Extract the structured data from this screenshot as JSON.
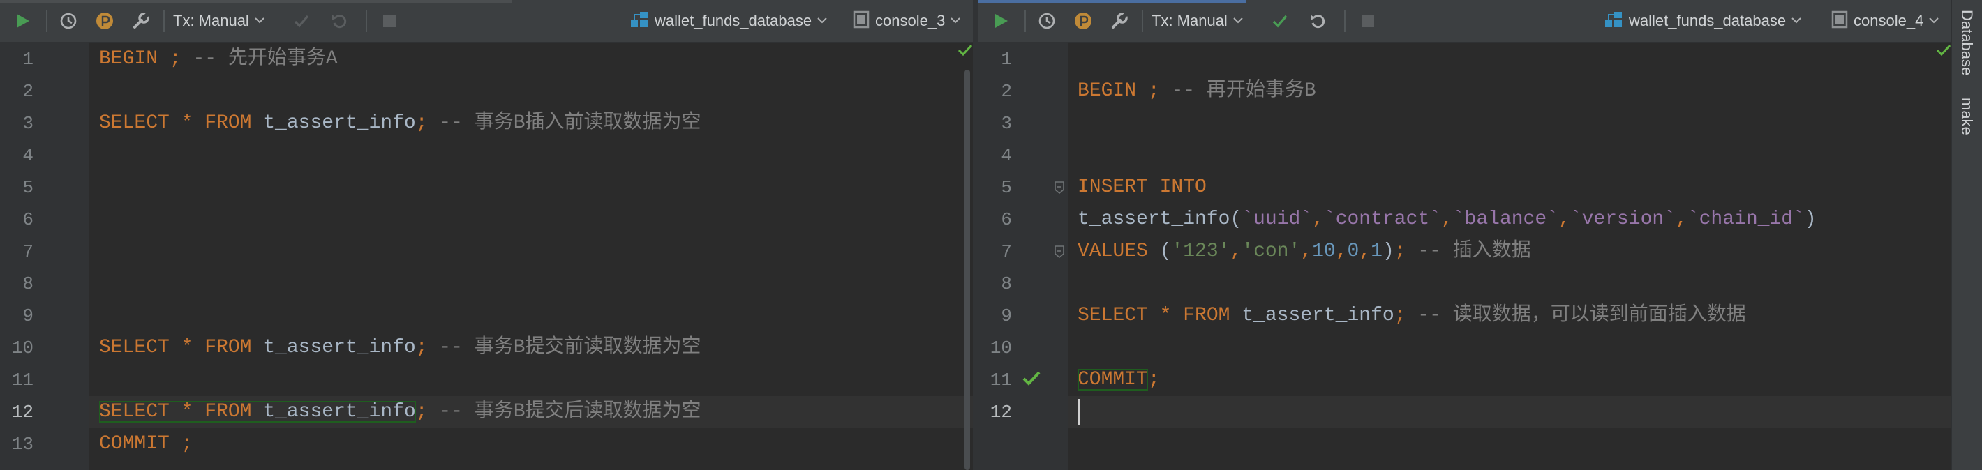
{
  "toolbar_left": {
    "tx_mode": "Tx: Manual",
    "datasource": "wallet_funds_database",
    "console": "console_3"
  },
  "toolbar_right": {
    "tx_mode": "Tx: Manual",
    "datasource": "wallet_funds_database",
    "console": "console_4"
  },
  "side_tabs": [
    "Database",
    "make"
  ],
  "colors": {
    "keyword": "#cc7832",
    "comment": "#808080",
    "string": "#6a8759",
    "number": "#6897bb",
    "quoted_identifier": "#9876aa",
    "run_green": "#499c54",
    "status_green": "#62b543"
  },
  "editor_left": {
    "line_numbers": [
      "1",
      "2",
      "3",
      "4",
      "5",
      "6",
      "7",
      "8",
      "9",
      "10",
      "11",
      "12",
      "13"
    ],
    "lines": [
      [
        [
          "kw",
          "BEGIN "
        ],
        [
          "op",
          ";"
        ],
        [
          "cm",
          " -- 先开始事务A"
        ]
      ],
      [],
      [
        [
          "kw",
          "SELECT "
        ],
        [
          "op",
          "* "
        ],
        [
          "kw",
          "FROM "
        ],
        [
          "id",
          "t_assert_info"
        ],
        [
          "op",
          ";"
        ],
        [
          "cm",
          " -- 事务B插入前读取数据为空"
        ]
      ],
      [],
      [],
      [],
      [],
      [],
      [],
      [
        [
          "kw",
          "SELECT "
        ],
        [
          "op",
          "* "
        ],
        [
          "kw",
          "FROM "
        ],
        [
          "id",
          "t_assert_info"
        ],
        [
          "op",
          ";"
        ],
        [
          "cm",
          " -- 事务B提交前读取数据为空"
        ]
      ],
      [],
      [
        [
          "kw",
          "SELECT "
        ],
        [
          "op",
          "* "
        ],
        [
          "kw",
          "FROM "
        ],
        [
          "id",
          "t_assert_info"
        ],
        [
          "op",
          ";"
        ],
        [
          "cm",
          " -- 事务B提交后读取数据为空"
        ]
      ],
      [
        [
          "kw",
          "COMMIT "
        ],
        [
          "op",
          ";"
        ]
      ]
    ]
  },
  "editor_right": {
    "line_numbers": [
      "1",
      "2",
      "3",
      "4",
      "5",
      "6",
      "7",
      "8",
      "9",
      "10",
      "11",
      "12"
    ],
    "lines": [
      [],
      [
        [
          "kw",
          "BEGIN "
        ],
        [
          "op",
          ";"
        ],
        [
          "cm",
          " -- 再开始事务B"
        ]
      ],
      [],
      [],
      [
        [
          "kw",
          "INSERT INTO"
        ]
      ],
      [
        [
          "id",
          "t_assert_info("
        ],
        [
          "qid",
          "`uuid`"
        ],
        [
          "op",
          ","
        ],
        [
          "qid",
          "`contract`"
        ],
        [
          "op",
          ","
        ],
        [
          "qid",
          "`balance`"
        ],
        [
          "op",
          ","
        ],
        [
          "qid",
          "`version`"
        ],
        [
          "op",
          ","
        ],
        [
          "qid",
          "`chain_id`"
        ],
        [
          "id",
          ")"
        ]
      ],
      [
        [
          "kw",
          "VALUES "
        ],
        [
          "id",
          "("
        ],
        [
          "str",
          "'123'"
        ],
        [
          "op",
          ","
        ],
        [
          "str",
          "'con'"
        ],
        [
          "op",
          ","
        ],
        [
          "num",
          "10"
        ],
        [
          "op",
          ","
        ],
        [
          "num",
          "0"
        ],
        [
          "op",
          ","
        ],
        [
          "num",
          "1"
        ],
        [
          "id",
          ")"
        ],
        [
          "op",
          ";"
        ],
        [
          "cm",
          " -- 插入数据"
        ]
      ],
      [],
      [
        [
          "kw",
          "SELECT "
        ],
        [
          "op",
          "* "
        ],
        [
          "kw",
          "FROM "
        ],
        [
          "id",
          "t_assert_info"
        ],
        [
          "op",
          ";"
        ],
        [
          "cm",
          " -- 读取数据，可以读到前面插入数据"
        ]
      ],
      [],
      [
        [
          "kw",
          "COMMIT"
        ],
        [
          "op",
          ";"
        ]
      ],
      []
    ]
  }
}
